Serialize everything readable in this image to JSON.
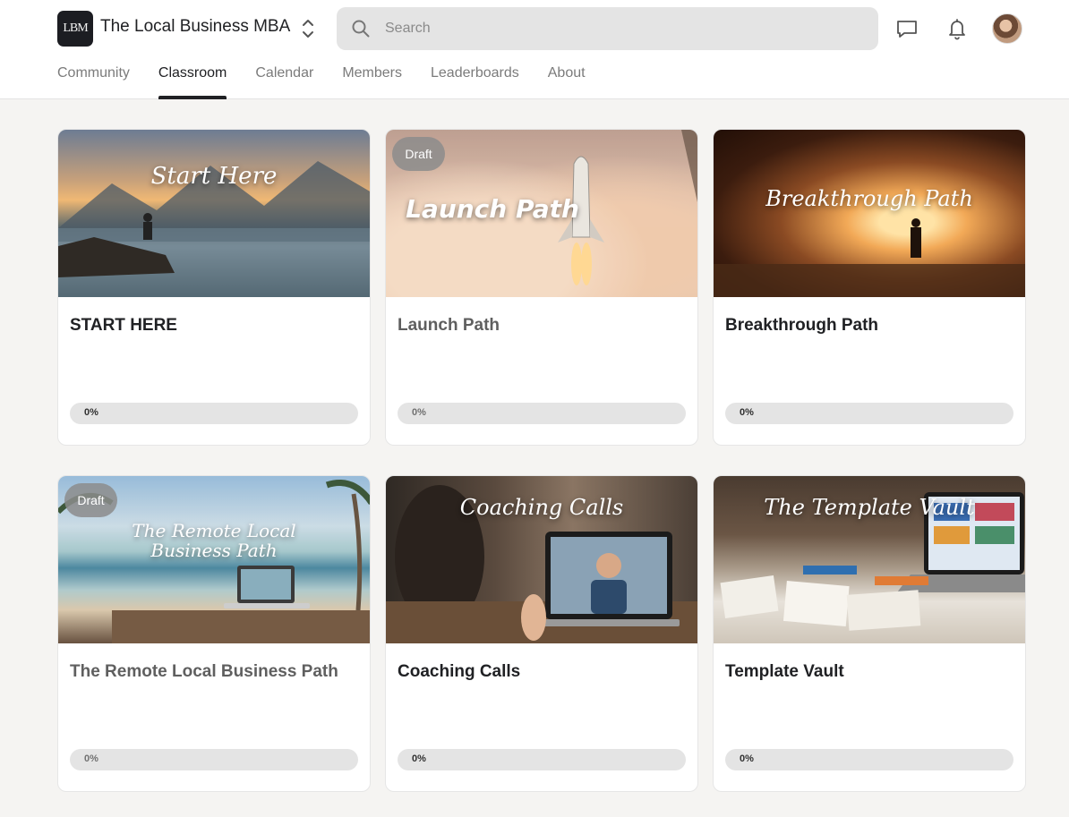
{
  "header": {
    "logo_text": "LBM",
    "brand_name": "The Local Business MBA",
    "search_placeholder": "Search",
    "icons": [
      "chevron-updown-icon",
      "search-icon",
      "chat-icon",
      "bell-icon"
    ]
  },
  "nav": {
    "tabs": [
      {
        "label": "Community",
        "active": false
      },
      {
        "label": "Classroom",
        "active": true
      },
      {
        "label": "Calendar",
        "active": false
      },
      {
        "label": "Members",
        "active": false
      },
      {
        "label": "Leaderboards",
        "active": false
      },
      {
        "label": "About",
        "active": false
      }
    ]
  },
  "courses": [
    {
      "title": "START HERE",
      "cover_text": "Start Here",
      "draft": false,
      "progress_percent": 0,
      "progress_label": "0%"
    },
    {
      "title": "Launch Path",
      "cover_text": "Launch Path",
      "draft": true,
      "draft_label": "Draft",
      "progress_percent": 0,
      "progress_label": "0%"
    },
    {
      "title": "Breakthrough Path",
      "cover_text": "Breakthrough Path",
      "draft": false,
      "progress_percent": 0,
      "progress_label": "0%"
    },
    {
      "title": "The Remote Local Business Path",
      "cover_text_line1": "The Remote Local",
      "cover_text_line2": "Business Path",
      "draft": true,
      "draft_label": "Draft",
      "progress_percent": 0,
      "progress_label": "0%"
    },
    {
      "title": "Coaching Calls",
      "cover_text": "Coaching Calls",
      "draft": false,
      "progress_percent": 0,
      "progress_label": "0%"
    },
    {
      "title": "Template Vault",
      "cover_text": "The Template Vault",
      "draft": false,
      "progress_percent": 0,
      "progress_label": "0%"
    }
  ],
  "colors": {
    "page_background": "#f5f4f2",
    "progress_track": "#e4e4e4",
    "draft_badge": "#828282",
    "active_tab": "#202124"
  }
}
